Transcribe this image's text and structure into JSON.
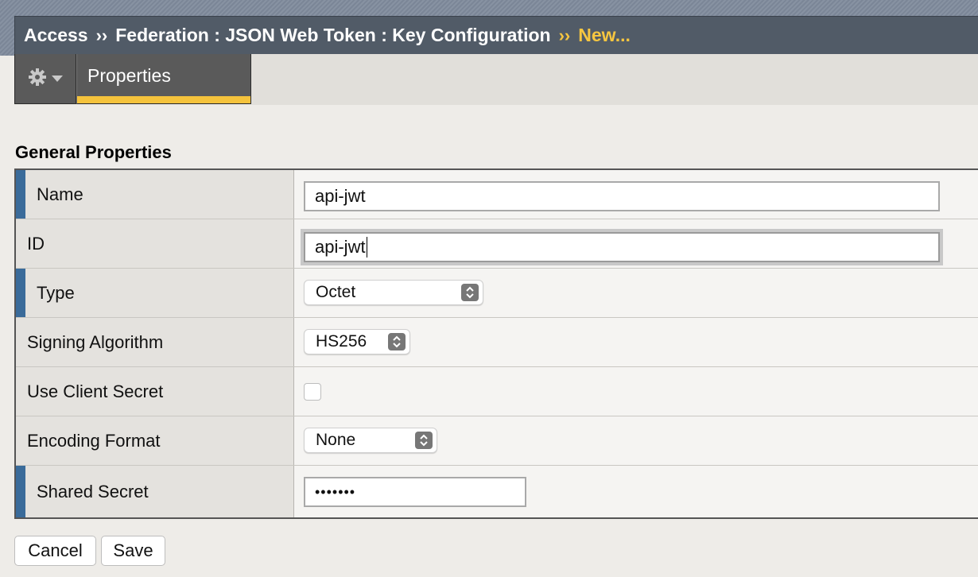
{
  "breadcrumb": {
    "items": [
      "Access",
      "Federation : JSON Web Token : Key Configuration"
    ],
    "separator": "››",
    "current": "New..."
  },
  "toolbar": {
    "gear_icon": "gear-icon",
    "menu_icon": "chevron-down-icon",
    "tab_label": "Properties"
  },
  "section": {
    "title": "General Properties"
  },
  "form": {
    "name": {
      "label": "Name",
      "value": "api-jwt"
    },
    "id": {
      "label": "ID",
      "value": "api-jwt"
    },
    "type": {
      "label": "Type",
      "selected": "Octet"
    },
    "signing_algorithm": {
      "label": "Signing Algorithm",
      "selected": "HS256"
    },
    "use_client_secret": {
      "label": "Use Client Secret",
      "checked": false
    },
    "encoding_format": {
      "label": "Encoding Format",
      "selected": "None"
    },
    "shared_secret": {
      "label": "Shared Secret",
      "masked_value": "•••••••"
    }
  },
  "actions": {
    "cancel_label": "Cancel",
    "save_label": "Save"
  },
  "colors": {
    "header_bg": "#515b67",
    "accent_yellow": "#f7c640",
    "required_marker": "#3a6b9a",
    "tab_bg": "#5a5a5a"
  }
}
